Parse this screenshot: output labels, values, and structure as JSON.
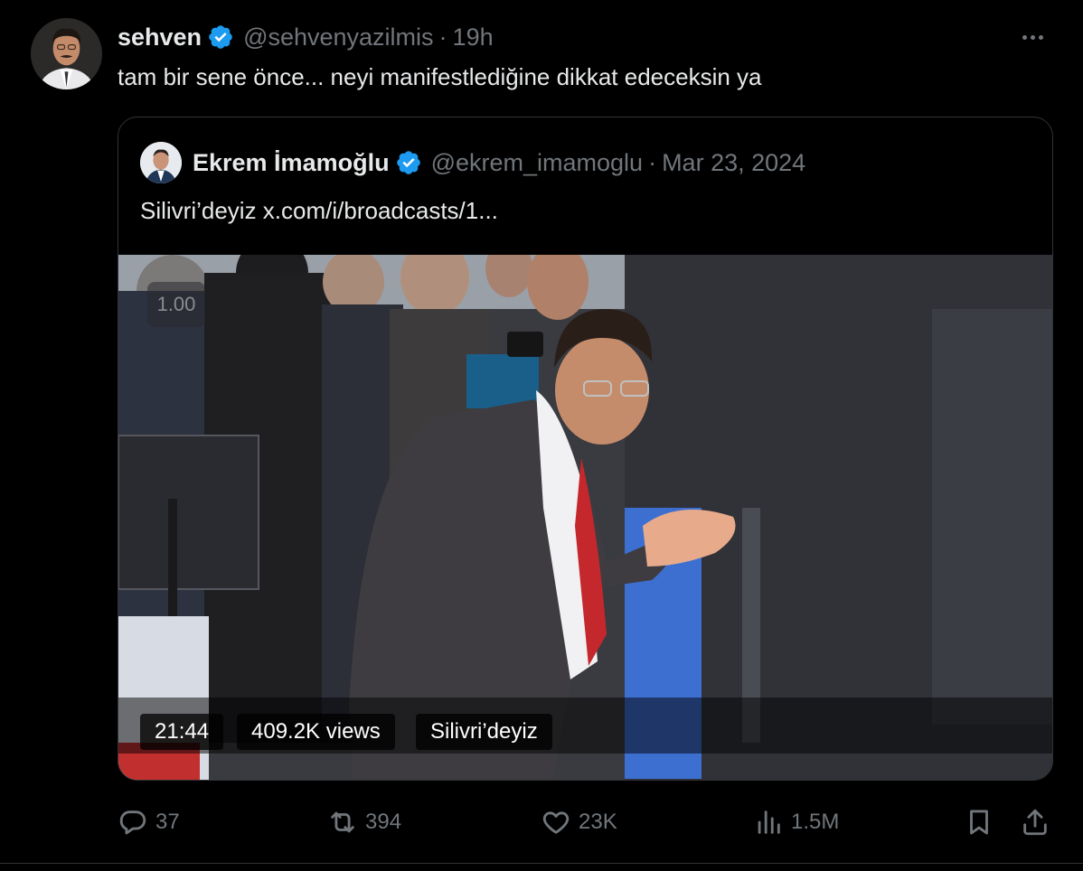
{
  "author": {
    "display_name": "sehven",
    "handle": "@sehvenyazilmis",
    "separator": "·",
    "time": "19h"
  },
  "tweet_text": "tam bir sene önce... neyi manifestlediğine dikkat edeceksin ya",
  "quoted": {
    "display_name": "Ekrem İmamoğlu",
    "handle": "@ekrem_imamoglu",
    "separator": "·",
    "date": "Mar 23, 2024",
    "text": "Silivri’deyiz x.com/i/broadcasts/1..."
  },
  "media": {
    "speed": "1.00",
    "duration": "21:44",
    "views": "409.2K views",
    "title": "Silivri’deyiz"
  },
  "actions": {
    "replies": "37",
    "reposts": "394",
    "likes": "23K",
    "views": "1.5M"
  },
  "icons": {
    "verified": "verified-badge-icon",
    "more": "more-options-icon",
    "reply": "reply-icon",
    "repost": "repost-icon",
    "like": "heart-icon",
    "views": "analytics-icon",
    "bookmark": "bookmark-icon",
    "share": "share-icon"
  },
  "colors": {
    "background": "#000000",
    "text_primary": "#e7e9ea",
    "text_secondary": "#71767b",
    "border": "#2f3336",
    "verified_blue": "#1d9bf0"
  }
}
